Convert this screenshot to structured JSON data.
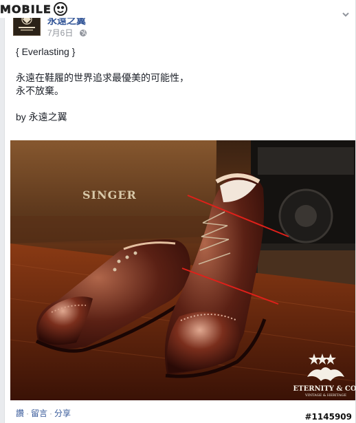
{
  "watermark": {
    "site": "MOBILE",
    "id": "#1145909"
  },
  "post": {
    "page_name": "永遠之翼",
    "date": "7月6日",
    "lines": [
      "{ Everlasting }",
      "永遠在鞋履的世界追求最優美的可能性，",
      "永不放棄。",
      "by 永遠之翼"
    ]
  },
  "photo": {
    "sign_text": "SINGER",
    "logo_name": "ETERNITY & CO.",
    "logo_tagline": "VINTAGE & HERITAGE"
  },
  "actions": {
    "like": "讚",
    "comment": "留言",
    "share": "分享",
    "separator": "·"
  },
  "colors": {
    "link": "#365899",
    "meta": "#90949c",
    "text": "#1d2129",
    "annotation": "#e0201a"
  }
}
